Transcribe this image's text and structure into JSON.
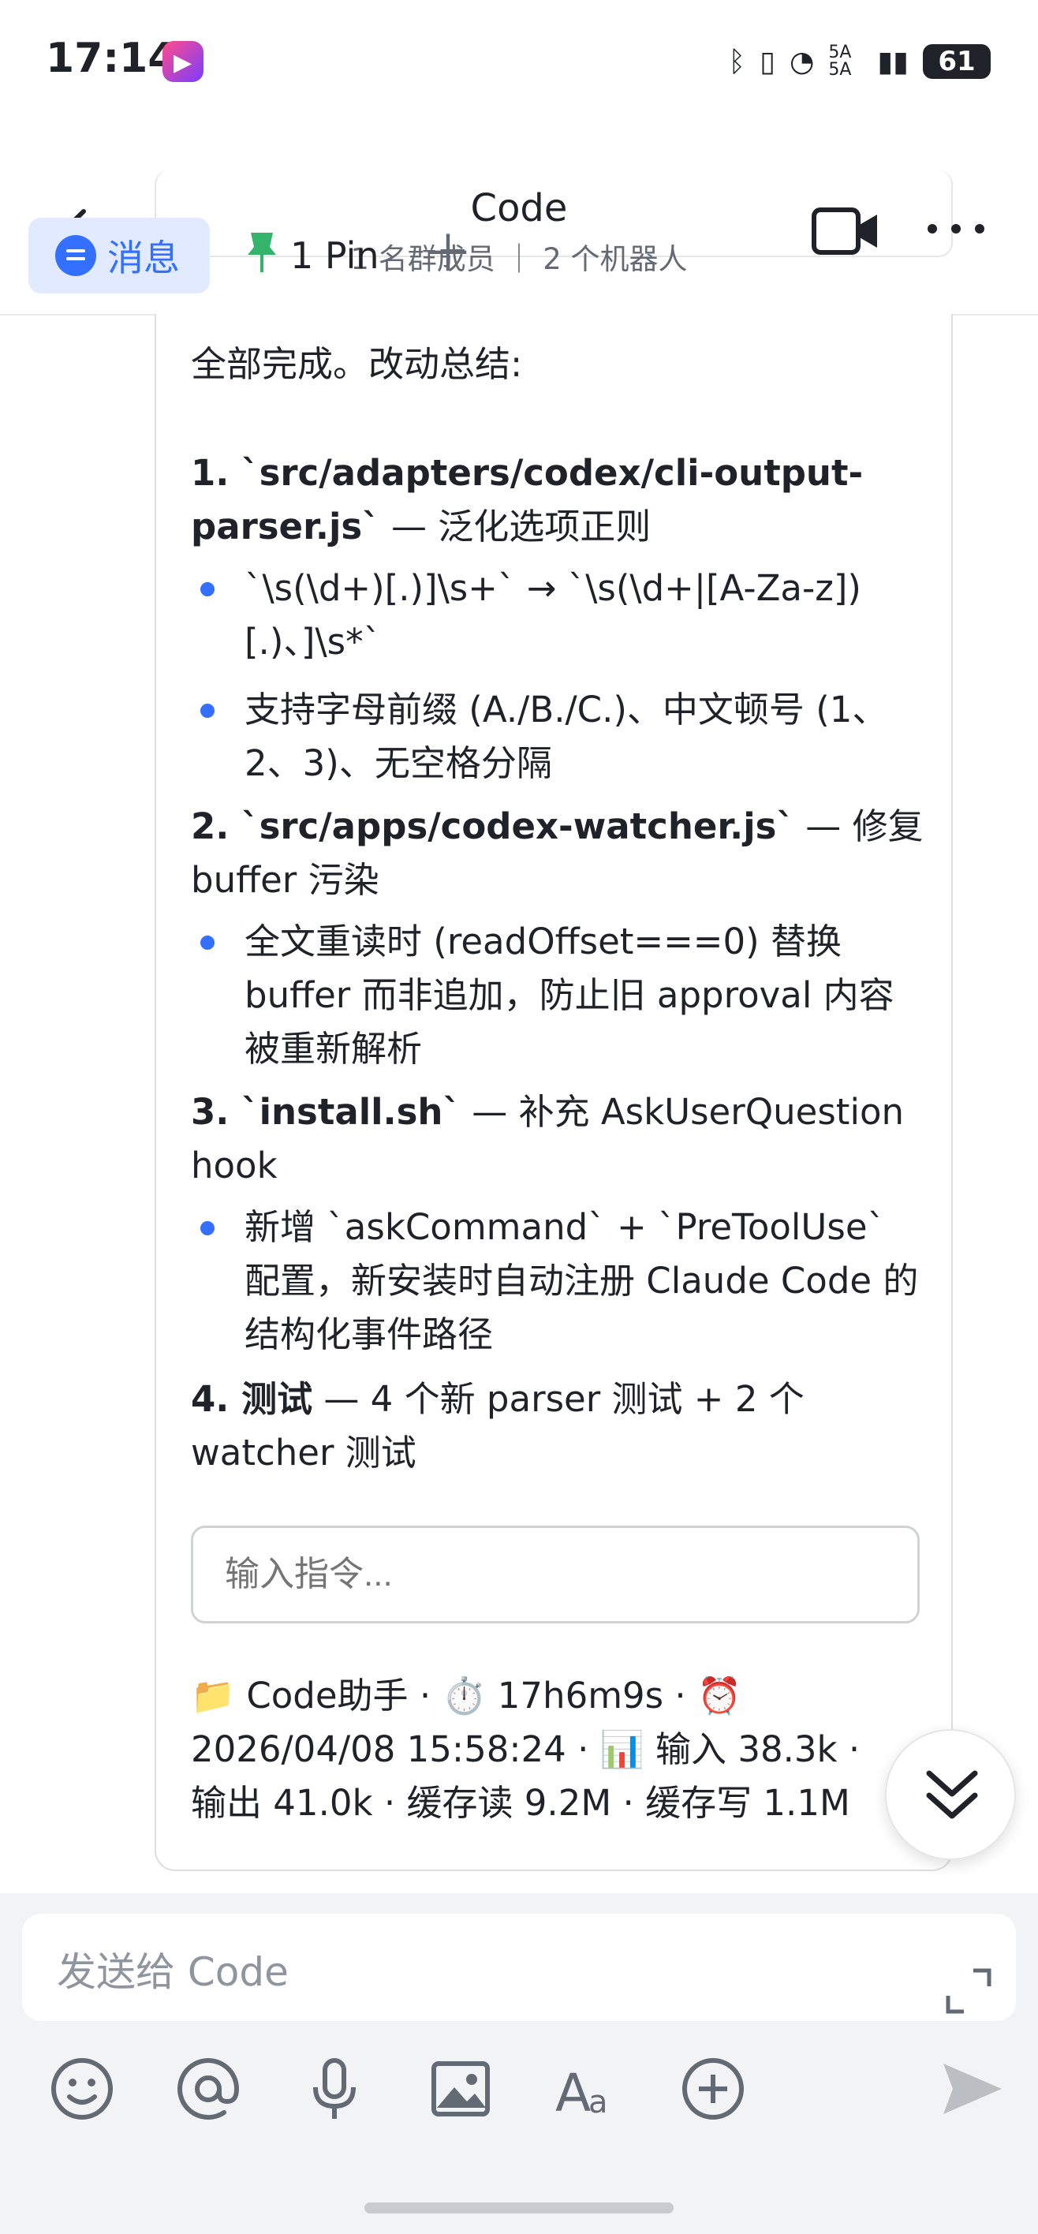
{
  "status_bar": {
    "time": "17:14",
    "network": "5A 5A",
    "battery": "61"
  },
  "header": {
    "title": "Code",
    "subtitle": "1 名群成员 ｜ 2 个机器人",
    "ghost_title": "✓ 全部完成。改动总结:",
    "tabs": {
      "messages": "消息",
      "pin": "1 Pin"
    }
  },
  "message": {
    "intro": "全部完成。改动总结:",
    "items": [
      {
        "heading": "1. `src/adapters/codex/cli-output-parser.js`",
        "desc": " — 泛化选项正则",
        "bullets": [
          "`\\s(\\d+)[.)]\\s+` → `\\s(\\d+|[A-Za-z])[.)、]\\s*`",
          "支持字母前缀 (A./B./C.)、中文顿号 (1、2、3)、无空格分隔"
        ]
      },
      {
        "heading": "2. `src/apps/codex-watcher.js`",
        "desc": " — 修复 buffer 污染",
        "bullets": [
          "全文重读时 (readOffset===0) 替换 buffer 而非追加，防止旧 approval 内容被重新解析"
        ]
      },
      {
        "heading": "3. `install.sh`",
        "desc": " — 补充 AskUserQuestion hook",
        "bullets": [
          "新增 `askCommand` + `PreToolUse` 配置，新安装时自动注册 Claude Code 的结构化事件路径"
        ]
      },
      {
        "heading": "4. 测试",
        "desc": " — 4 个新 parser 测试 + 2 个 watcher 测试",
        "bullets": []
      }
    ],
    "command_placeholder": "输入指令...",
    "meta_line1": "📁 Code助手 · ⏱️ 17h6m9s · ⏰",
    "meta_line2": "2026/04/08 15:58:24 · 📊 输入 38.3k ·",
    "meta_line3": "输出 41.0k · 缓存读 9.2M · 缓存写 1.1M"
  },
  "composer": {
    "placeholder": "发送给 Code"
  },
  "colors": {
    "accent": "#3370ff",
    "tab_bg": "#e1eaff",
    "composer_bg": "#f2f3f5",
    "pin_green": "#34b36b"
  },
  "icons": [
    "back-icon",
    "video-call-icon",
    "more-icon",
    "message-icon",
    "pin-icon",
    "add-icon",
    "scroll-down-icon",
    "emoji-icon",
    "mention-icon",
    "microphone-icon",
    "image-icon",
    "text-format-icon",
    "plus-circle-icon",
    "send-icon",
    "expand-icon"
  ]
}
